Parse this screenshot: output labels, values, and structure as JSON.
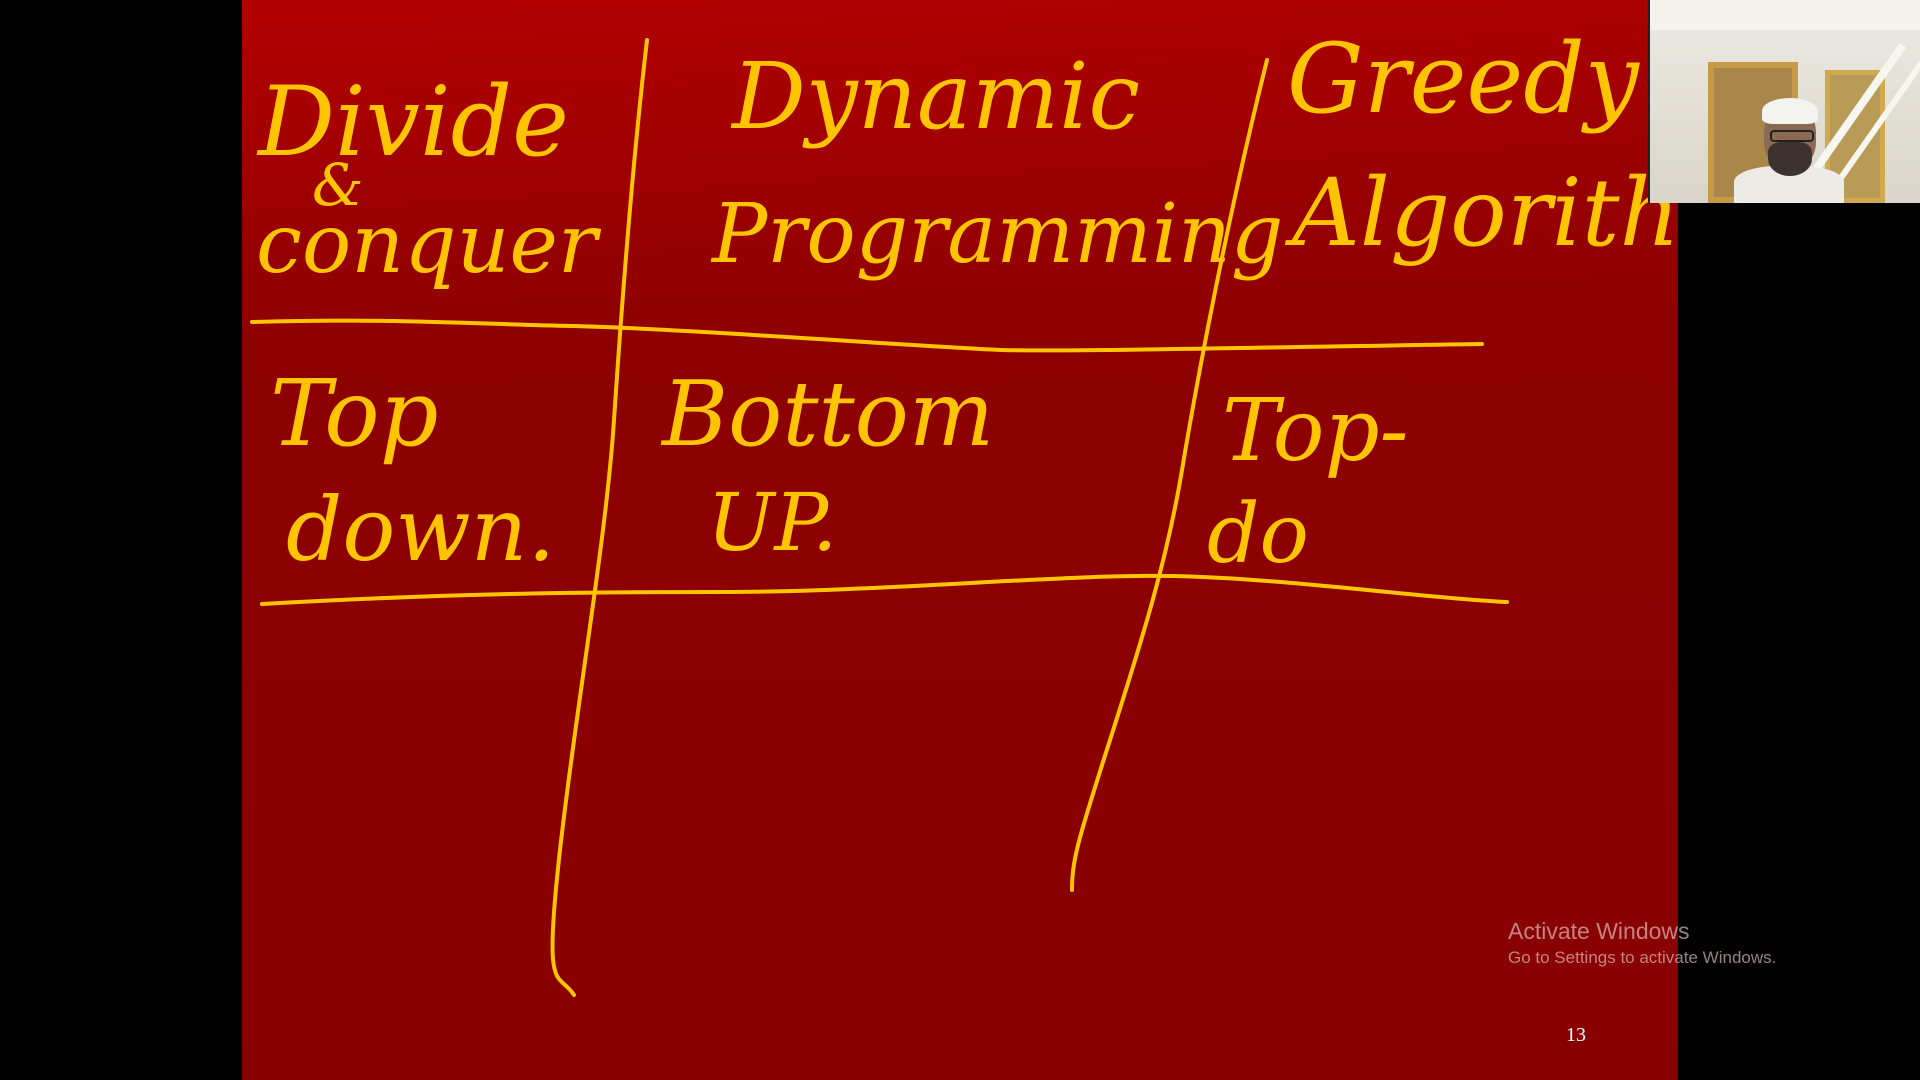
{
  "slide": {
    "background_color": "#8b0000",
    "ink_color": "#ffc107",
    "handwriting": {
      "col1_header_line1": "Divide",
      "col1_header_line2": "&",
      "col1_header_line3": "conquer",
      "col2_header_line1": "Dynamic",
      "col2_header_line2": "Programming",
      "col3_header_line1": "Greedy",
      "col3_header_line2": "Algorithm",
      "col1_row1_line1": "Top",
      "col1_row1_line2": "down.",
      "col2_row1_line1": "Bottom",
      "col2_row1_line2": "UP.",
      "col3_row1_line1": "Top-",
      "col3_row1_line2": "do"
    },
    "page_number": "13"
  },
  "watermark": {
    "title": "Activate Windows",
    "subtitle": "Go to Settings to activate Windows."
  },
  "webcam": {
    "icon": "presenter-webcam-feed"
  }
}
